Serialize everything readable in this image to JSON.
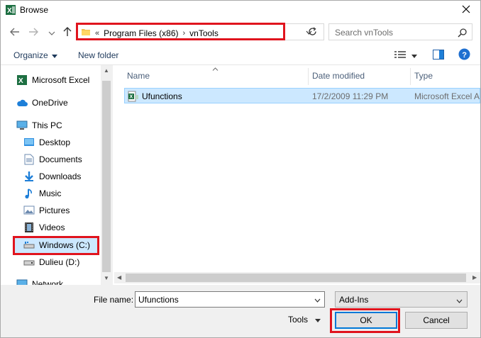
{
  "window": {
    "title": "Browse",
    "colors": {
      "accent": "#0078d7",
      "highlight": "#e0141e",
      "selection": "#cce8ff",
      "excel": "#1d6f42"
    }
  },
  "address": {
    "prefix": "«",
    "segments": [
      "Program Files (x86)",
      "vnTools"
    ],
    "separator": "›"
  },
  "search": {
    "placeholder": "Search vnTools"
  },
  "toolbar": {
    "organize": "Organize",
    "new_folder": "New folder"
  },
  "sidebar": {
    "items": [
      {
        "label": "Microsoft Excel",
        "icon": "excel-icon"
      },
      {
        "label": "OneDrive",
        "icon": "cloud-icon"
      },
      {
        "label": "This PC",
        "icon": "computer-icon"
      },
      {
        "label": "Desktop",
        "icon": "desktop-icon"
      },
      {
        "label": "Documents",
        "icon": "documents-icon"
      },
      {
        "label": "Downloads",
        "icon": "download-icon"
      },
      {
        "label": "Music",
        "icon": "music-icon"
      },
      {
        "label": "Pictures",
        "icon": "pictures-icon"
      },
      {
        "label": "Videos",
        "icon": "videos-icon"
      },
      {
        "label": "Windows (C:)",
        "icon": "drive-icon",
        "selected": true
      },
      {
        "label": "Dulieu (D:)",
        "icon": "drive-icon"
      },
      {
        "label": "Network",
        "icon": "network-icon"
      }
    ]
  },
  "columns": {
    "name": "Name",
    "date": "Date modified",
    "type": "Type"
  },
  "files": [
    {
      "name": "Ufunctions",
      "date": "17/2/2009 11:29 PM",
      "type": "Microsoft Excel A",
      "icon": "excel-addin-icon"
    }
  ],
  "footer": {
    "file_name_label": "File name:",
    "file_name_value": "Ufunctions",
    "filter": "Add-Ins",
    "tools": "Tools",
    "ok": "OK",
    "cancel": "Cancel"
  }
}
